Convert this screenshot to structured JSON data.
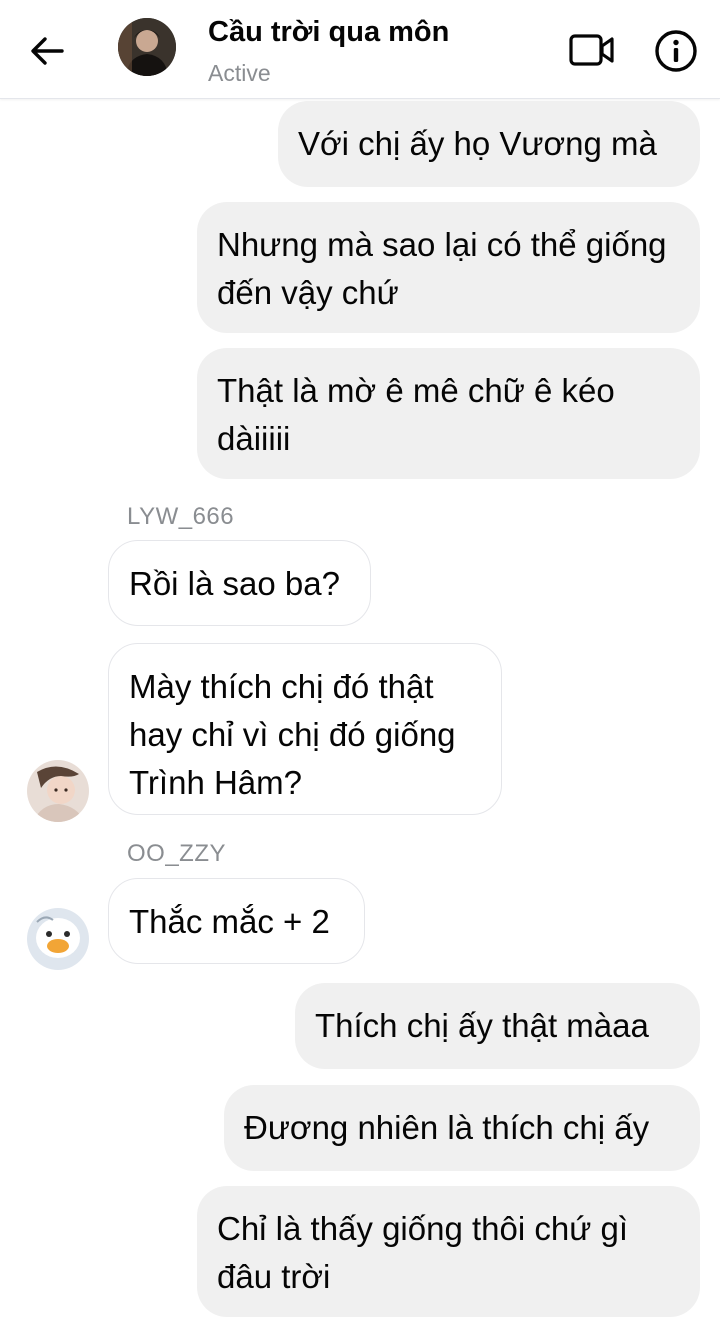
{
  "header": {
    "title": "Cầu trời qua môn",
    "status": "Active",
    "back_icon": "arrow-left-icon",
    "video_icon": "video-camera-icon",
    "info_icon": "info-icon"
  },
  "messages": [
    {
      "from": "me",
      "text": "Với chị ấy họ Vương mà"
    },
    {
      "from": "me",
      "text": "Nhưng mà sao lại có thể giống đến vậy chứ"
    },
    {
      "from": "me",
      "text": "Thật là mờ ê mê chữ ê kéo dàiiiii"
    },
    {
      "from": "LYW_666",
      "text": "Rồi là sao ba?"
    },
    {
      "from": "LYW_666",
      "text": "Mày thích chị đó thật hay chỉ vì chị đó giống Trình Hâm?"
    },
    {
      "from": "OO_ZZY",
      "text": "Thắc mắc + 2"
    },
    {
      "from": "me",
      "text": "Thích chị ấy thật màaa"
    },
    {
      "from": "me",
      "text": "Đương nhiên là thích chị ấy"
    },
    {
      "from": "me",
      "text": "Chỉ là thấy giống thôi chứ gì đâu trời"
    }
  ],
  "senders": [
    "LYW_666",
    "OO_ZZY"
  ],
  "colors": {
    "my_bubble": "#f0f0f0",
    "their_bubble": "#ffffff",
    "sender_label": "#8a8d91",
    "status_text": "#8a8d91"
  }
}
